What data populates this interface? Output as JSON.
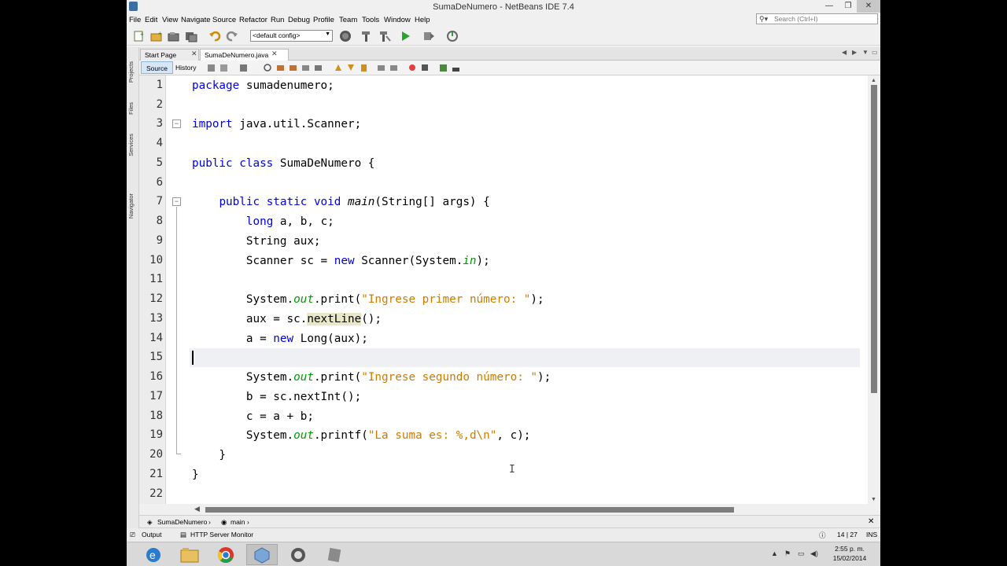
{
  "window": {
    "title": "SumaDeNumero - NetBeans IDE 7.4",
    "min_glyph": "—",
    "restore_glyph": "❐",
    "close_glyph": "✕"
  },
  "menu": [
    "File",
    "Edit",
    "View",
    "Navigate",
    "Source",
    "Refactor",
    "Run",
    "Debug",
    "Profile",
    "Team",
    "Tools",
    "Window",
    "Help"
  ],
  "search": {
    "placeholder": "Search (Ctrl+I)",
    "icon": "search-icon"
  },
  "toolbar": {
    "config": "<default config>"
  },
  "side_panels": [
    "Projects",
    "Files",
    "Services",
    "Navigator"
  ],
  "tabs": [
    {
      "label": "Start Page",
      "active": false
    },
    {
      "label": "SumaDeNumero.java",
      "active": true
    }
  ],
  "editor_toolbar": {
    "source": "Source",
    "history": "History"
  },
  "editor": {
    "line_numbers": [
      "1",
      "2",
      "3",
      "4",
      "5",
      "6",
      "7",
      "8",
      "9",
      "10",
      "11",
      "12",
      "13",
      "14",
      "15",
      "16",
      "17",
      "18",
      "19",
      "20",
      "21",
      "22"
    ],
    "current_line": 15,
    "colors": {
      "keyword": "#0000e6",
      "string": "#ce7b00",
      "field": "#009900"
    }
  },
  "breadcrumb": [
    "SumaDeNumero",
    "main"
  ],
  "bottom": {
    "output": "Output",
    "http_monitor": "HTTP Server Monitor",
    "position": "14 | 27",
    "mode": "INS"
  },
  "taskbar": {
    "time": "2:55 p. m.",
    "date": "15/02/2014",
    "apps": [
      "internet-explorer-icon",
      "file-explorer-icon",
      "chrome-icon",
      "netbeans-icon",
      "app-icon",
      "notepad-icon"
    ]
  }
}
